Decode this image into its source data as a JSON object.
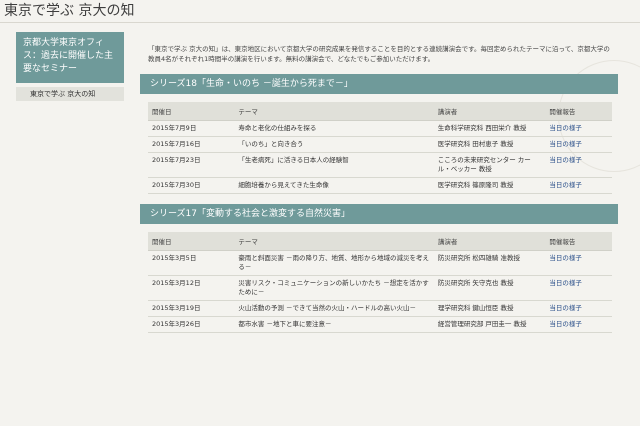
{
  "page": {
    "title": "東京で学ぶ 京大の知"
  },
  "sidebar": {
    "box_text": "京都大学東京オフィス：過去に開催した主要なセミナー",
    "link": "東京で学ぶ 京大の知"
  },
  "intro": "「東京で学ぶ 京大の知」は、東京地区において京都大学の研究成果を発信することを目的とする連続講演会です。毎回定められたテーマに沿って、京都大学の教員4名がそれぞれ1時間半の講演を行います。無料の講演会で、どなたでもご参加いただけます。",
  "table_headers": {
    "date": "開催日",
    "theme": "テーマ",
    "lecturer": "講演者",
    "report": "開催報告"
  },
  "series": [
    {
      "title": "シリーズ18「生命・いのち －誕生から死まで－」",
      "rows": [
        {
          "date": "2015年7月9日",
          "theme": "寿命と老化の仕組みを探る",
          "lecturer": "生命科学研究科 西田栄介 教授",
          "report": "当日の様子"
        },
        {
          "date": "2015年7月16日",
          "theme": "「いのち」と向き合う",
          "lecturer": "医学研究科 田村恵子 教授",
          "report": "当日の様子"
        },
        {
          "date": "2015年7月23日",
          "theme": "「生老病死」に活きる日本人の経験智",
          "lecturer": "こころの未来研究センター カール・ベッカー 教授",
          "report": "当日の様子"
        },
        {
          "date": "2015年7月30日",
          "theme": "細胞培養から見えてきた生命像",
          "lecturer": "医学研究科 篠原隆司 教授",
          "report": "当日の様子"
        }
      ]
    },
    {
      "title": "シリーズ17「変動する社会と激変する自然災害」",
      "rows": [
        {
          "date": "2015年3月5日",
          "theme": "豪雨と斜面災害 －雨の降り方、地質、地形から地域の減災を考える－",
          "lecturer": "防災研究所 松四雄騎 准教授",
          "report": "当日の様子"
        },
        {
          "date": "2015年3月12日",
          "theme": "災害リスク・コミュニケーションの新しいかたち －想定を活かすために－",
          "lecturer": "防災研究所 矢守克也 教授",
          "report": "当日の様子"
        },
        {
          "date": "2015年3月19日",
          "theme": "火山活動の予測 －できて当然の火山・ハードルの高い火山－",
          "lecturer": "理学研究科 鍵山恒臣 教授",
          "report": "当日の様子"
        },
        {
          "date": "2015年3月26日",
          "theme": "都市水害 －地下と車に要注意－",
          "lecturer": "経営管理研究部 戸田圭一 教授",
          "report": "当日の様子"
        }
      ]
    }
  ]
}
